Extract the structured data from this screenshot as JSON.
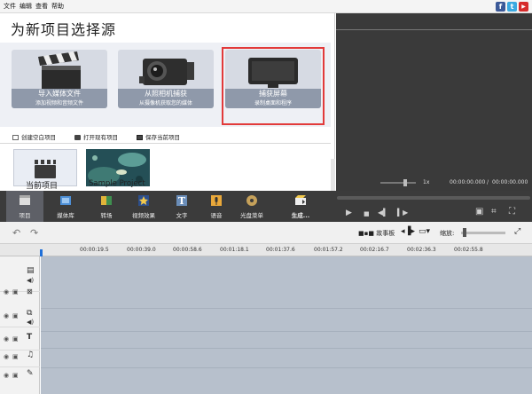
{
  "menu": [
    "文件",
    "编辑",
    "查看",
    "帮助"
  ],
  "social": [
    {
      "name": "facebook",
      "glyph": "f",
      "color": "#3b5998"
    },
    {
      "name": "twitter",
      "glyph": "t",
      "color": "#3ba9e0"
    },
    {
      "name": "youtube",
      "glyph": "▶",
      "color": "#d62b2b"
    }
  ],
  "heading": "为新项目选择源",
  "sources": [
    {
      "title": "导入媒体文件",
      "subtitle": "添加视频和音频文件",
      "icon": "clapperboard-icon"
    },
    {
      "title": "从照相机捕获",
      "subtitle": "从摄像机获取您的媒体",
      "icon": "camcorder-icon"
    },
    {
      "title": "捕获屏幕",
      "subtitle": "录制桌面和程序",
      "icon": "monitor-icon",
      "highlighted": true
    }
  ],
  "actions": [
    "创建空白项目",
    "打开现有项目",
    "保存当前项目"
  ],
  "projects": [
    "当前项目",
    "Sample Project"
  ],
  "preview": {
    "speed": "1x",
    "time_current": "00:00:00.000",
    "time_separator": "/",
    "time_total": "00:00:00.000"
  },
  "toolbar": [
    {
      "label": "项目",
      "icon": "film-icon",
      "active": true
    },
    {
      "label": "媒体库",
      "icon": "media-library-icon"
    },
    {
      "label": "转场",
      "icon": "transitions-icon"
    },
    {
      "label": "视频效果",
      "icon": "video-effects-icon"
    },
    {
      "label": "文字",
      "icon": "text-icon"
    },
    {
      "label": "语音",
      "icon": "microphone-icon"
    },
    {
      "label": "光盘菜单",
      "icon": "disc-menu-icon"
    },
    {
      "label": "生成...",
      "icon": "produce-icon",
      "bold": true
    }
  ],
  "timeline": {
    "storyboard_label": "故事板",
    "zoom_label": "缩放:",
    "ticks": [
      "00:00:19.5",
      "00:00:39.0",
      "00:00:58.6",
      "00:01:18.1",
      "00:01:37.6",
      "00:01:57.2",
      "00:02:16.7",
      "00:02:36.3",
      "00:02:55.8"
    ]
  },
  "colors": {
    "highlight": "#e23a3a",
    "toolbar_bg": "#3b3b3b",
    "track_bg": "#b7c0cc",
    "preview_bg": "#3a3a3a"
  }
}
